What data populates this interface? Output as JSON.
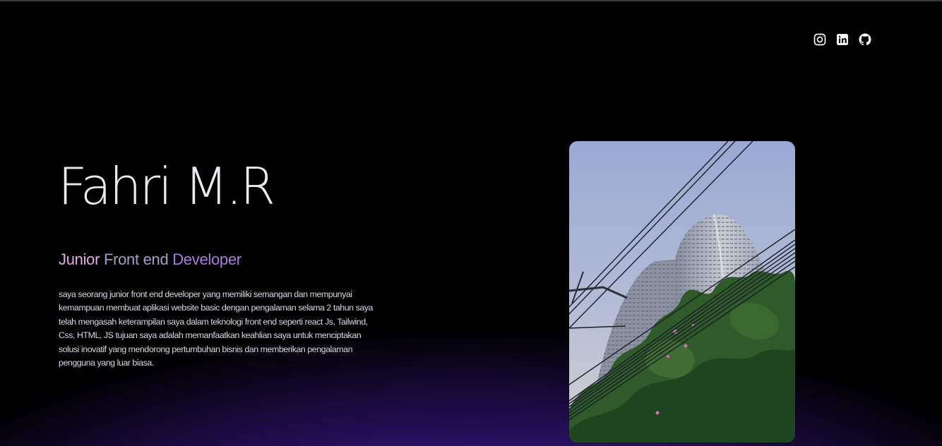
{
  "socials": [
    {
      "name": "instagram",
      "icon": "instagram-icon"
    },
    {
      "name": "linkedin",
      "icon": "linkedin-icon"
    },
    {
      "name": "github",
      "icon": "github-icon"
    }
  ],
  "hero": {
    "name": "Fahri M.R",
    "role_words": [
      "Junior",
      "Front end",
      "Developer"
    ],
    "bio": "saya seorang junior front end developer yang memiliki semangan dan mempunyai kemampuan membuat aplikasi website basic dengan pengalaman selama 2 tahun saya telah mengasah keterampilan saya dalam teknologi front end seperti react Js, Tailwind, Css, HTML, JS tujuan saya adalah memanfaatkan keahlian saya untuk menciptakan solusi inovatif yang mendorong pertumbuhan bisnis dan memberikan pengalaman pengguna yang luar biasa."
  },
  "colors": {
    "background_top": "#000000",
    "background_glow": "#4a1fa3",
    "role_junior": "#e8a8e8",
    "role_front": "#a59ec4",
    "role_developer": "#a77ee0",
    "text": "#d8d6e2"
  }
}
